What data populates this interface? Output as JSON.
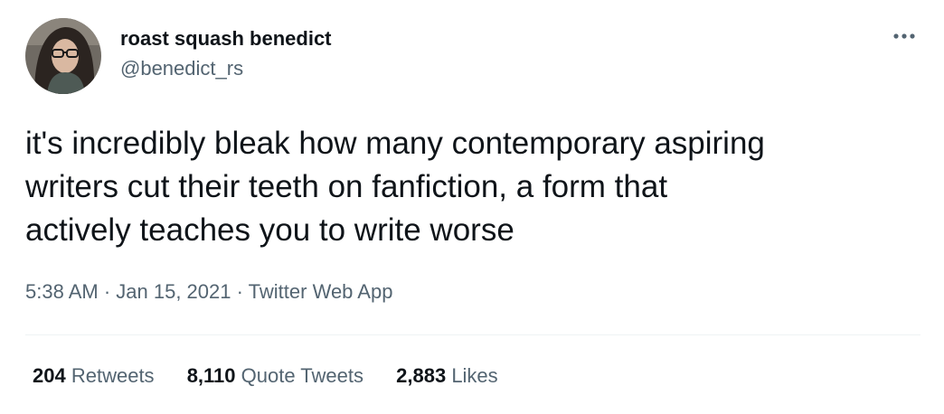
{
  "author": {
    "display_name": "roast squash benedict",
    "handle": "@benedict_rs"
  },
  "tweet": {
    "text_lines": [
      "it's incredibly bleak how many contemporary aspiring",
      "writers cut their teeth on fanfiction, a form that",
      "actively teaches you to write worse"
    ],
    "time": "5:38 AM",
    "date": "Jan 15, 2021",
    "source": "Twitter Web App",
    "separator": " · "
  },
  "stats": {
    "retweets": {
      "value": "204",
      "label": "Retweets"
    },
    "quote_tweets": {
      "value": "8,110",
      "label": "Quote Tweets"
    },
    "likes": {
      "value": "2,883",
      "label": "Likes"
    }
  },
  "icons": {
    "more": "more-options-icon"
  },
  "colors": {
    "primary_text": "#0f1419",
    "secondary_text": "#536471",
    "divider": "#eff3f4",
    "background": "#ffffff"
  }
}
